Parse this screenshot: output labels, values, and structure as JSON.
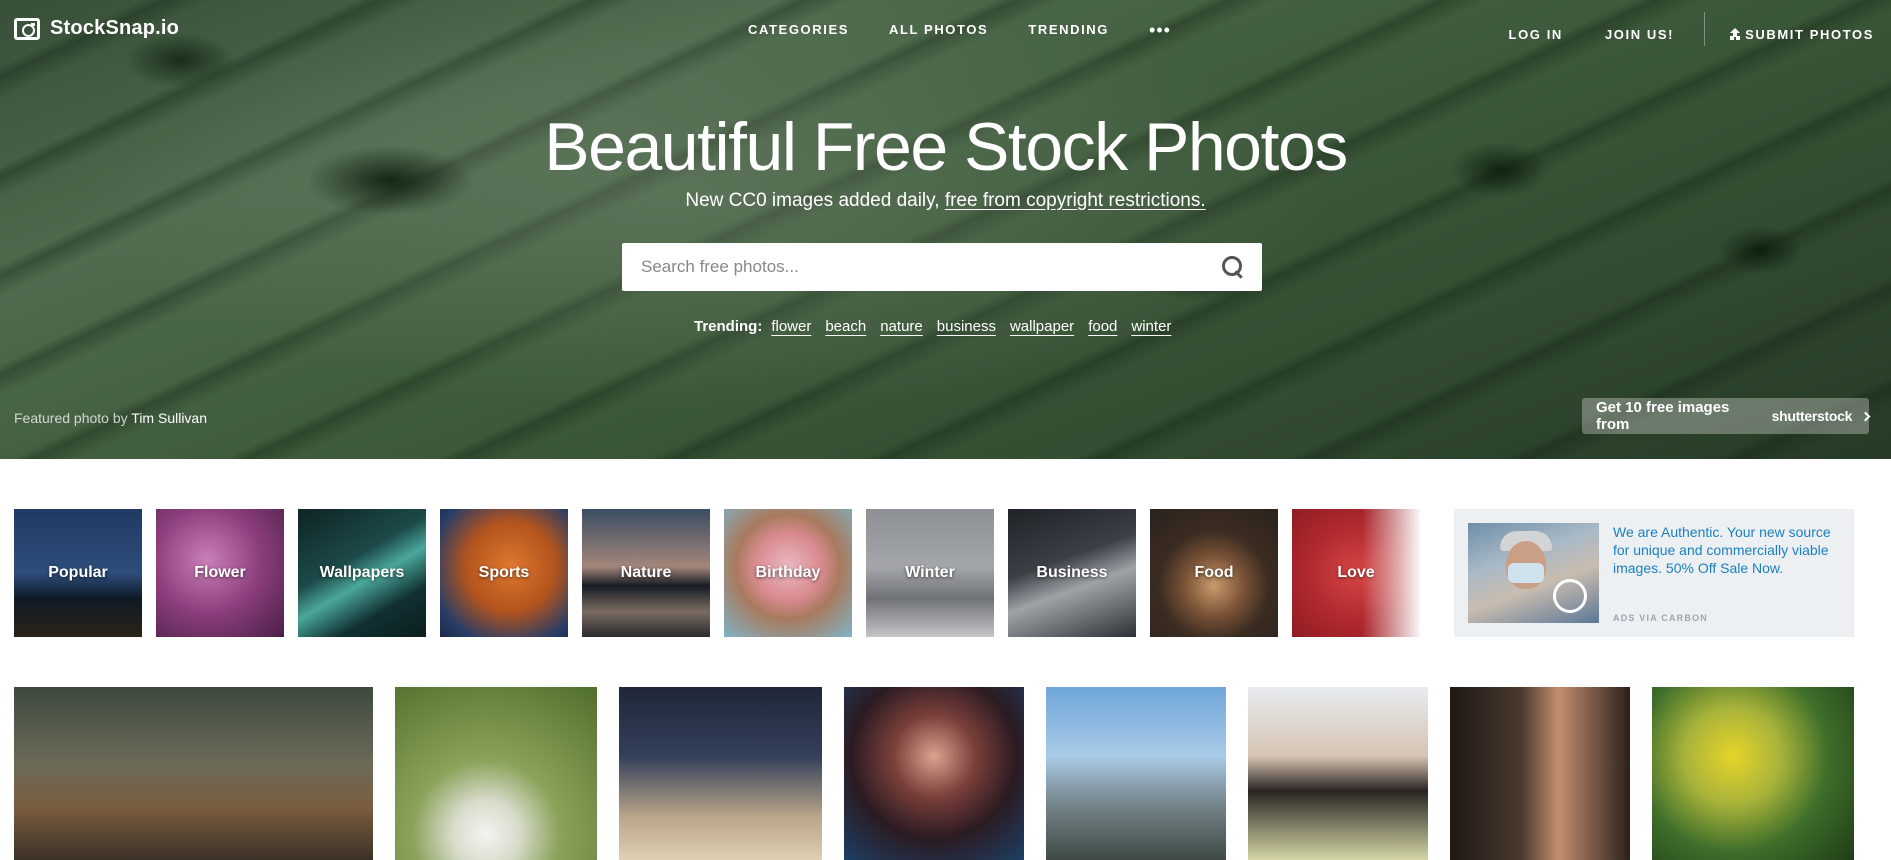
{
  "header": {
    "logo_text": "StockSnap.io",
    "nav_center": [
      "CATEGORIES",
      "ALL PHOTOS",
      "TRENDING"
    ],
    "more_label": "•••",
    "login": "LOG IN",
    "join": "JOIN US!",
    "submit": "SUBMIT PHOTOS"
  },
  "hero": {
    "title": "Beautiful Free Stock Photos",
    "subtitle_plain": "New CC0 images added daily, ",
    "subtitle_link": "free from copyright restrictions.",
    "search_placeholder": "Search free photos...",
    "trending_label": "Trending:",
    "trending_tags": [
      "flower",
      "beach",
      "nature",
      "business",
      "wallpaper",
      "food",
      "winter"
    ],
    "featured_prefix": "Featured photo by ",
    "featured_author": "Tim Sullivan",
    "shutter_cta": "Get 10 free images from",
    "shutter_brand": "shutterstock"
  },
  "categories": [
    {
      "label": "Popular",
      "bg": "linear-gradient(180deg,#1f3b63 0%,#2e4d7a 50%,#0f1a26 70%,#2a2418 100%)"
    },
    {
      "label": "Flower",
      "bg": "radial-gradient(circle at 40% 40%,#c97fb8 0%,#8a3d7c 50%,#4a1f45 100%)"
    },
    {
      "label": "Wallpapers",
      "bg": "linear-gradient(150deg,#0f2325 0%,#1c4a49 40%,#4aa79a 55%,#113032 75%,#0b1d1f 100%)"
    },
    {
      "label": "Sports",
      "bg": "radial-gradient(circle at 55% 45%,#e0772e 0%,#b2541e 45%,#2a3d66 80%,#1b2a4a 100%)"
    },
    {
      "label": "Nature",
      "bg": "linear-gradient(180deg,#3a4d63 0%,#a3867a 45%,#161c24 60%,#7a6b62 80%,#2b2a2e 100%)"
    },
    {
      "label": "Birthday",
      "bg": "radial-gradient(circle at 50% 45%,#e9b9c3 0%,#d98a8f 35%,#a87a5e 55%,#7fb4c7 100%)"
    },
    {
      "label": "Winter",
      "bg": "linear-gradient(180deg,#8d9196 0%,#a3a6aa 45%,#6f7276 70%,#c4c6c8 100%)"
    },
    {
      "label": "Business",
      "bg": "linear-gradient(160deg,#1e2328 0%,#3b4046 40%,#9ea3a8 60%,#2d3136 100%)"
    },
    {
      "label": "Food",
      "bg": "radial-gradient(circle at 50% 60%,#c99a6b 0%,#7a5236 30%,#3b2c22 55%,#2a211c 100%)"
    },
    {
      "label": "Love",
      "bg": "radial-gradient(circle at 50% 50%,#d64545 0%,#b22a2f 50%,#8e1c22 100%)"
    }
  ],
  "ad": {
    "text": "We are Authentic. Your new source for unique and commercially viable images. 50% Off Sale Now.",
    "via": "ADS VIA CARBON"
  },
  "photos": [
    {
      "name": "coyote-forest",
      "bg": "linear-gradient(180deg,#3d4a3f 0%,#6d6a58 45%,#7a5c3f 70%,#3a3126 100%)"
    },
    {
      "name": "white-flower",
      "bg": "radial-gradient(circle at 45% 85%,#f4f4f0 0%,#d8dccb 18%,#8aa35a 40%,#4f6d2c 100%)"
    },
    {
      "name": "dry-grass",
      "bg": "linear-gradient(180deg,#1f2638 0%,#33405a 40%,#b9a58a 75%,#e0cfb2 100%)"
    },
    {
      "name": "woman-portrait",
      "bg": "radial-gradient(circle at 50% 40%,#d9a48f 0%,#7a3f3a 30%,#2b1b22 60%,#1d3f66 100%)"
    },
    {
      "name": "city-skyline",
      "bg": "linear-gradient(180deg,#6fa6d8 0%,#a9cbe8 40%,#7a8a92 65%,#3f4a44 100%)"
    },
    {
      "name": "hair-tie",
      "bg": "linear-gradient(180deg,#e8ecef 0%,#d6c4b3 40%,#2a2422 60%,#d5d6a6 100%)"
    },
    {
      "name": "window-portrait",
      "bg": "linear-gradient(90deg,#1f1814 0%,#4a3a2e 40%,#c48f6e 60%,#2b201a 100%)"
    },
    {
      "name": "yellow-flowers",
      "bg": "radial-gradient(circle at 40% 40%,#e7d42a 0%,#a8b33a 30%,#3e6e2a 60%,#1f3d16 100%)"
    }
  ]
}
